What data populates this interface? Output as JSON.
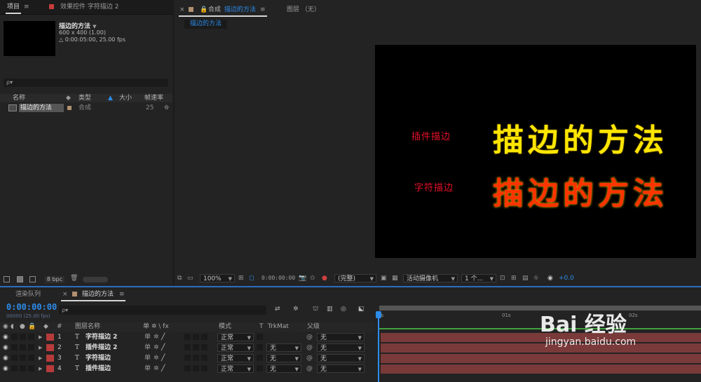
{
  "project_panel": {
    "tab_label": "项目",
    "effects_tab_label": "效果控件 字符描边 2",
    "comp_name": "描边的方法",
    "comp_size": "600 x 400 (1.00)",
    "comp_duration": "△ 0:00:05:00, 25.00 fps",
    "search_placeholder": "ρ▾",
    "columns": {
      "name": "名称",
      "type": "类型",
      "size": "大小",
      "fps": "帧速率"
    },
    "item": {
      "name": "描边的方法",
      "type": "合成",
      "fps": "25"
    },
    "bpc": "8 bpc"
  },
  "comp_panel": {
    "tab_label": "合成",
    "tab_comp_name": "描边的方法",
    "layer_tab_label": "图层 （无）",
    "breadcrumb": "描边的方法",
    "text_plugin_label": "插件描边",
    "text_char_label": "字符描边",
    "big_text_1": "描边的方法",
    "big_text_2": "描边的方法",
    "zoom": "100%",
    "timecode": "0:00:00:00",
    "resolution": "(完整)",
    "camera": "活动摄像机",
    "views": "1 个...",
    "exposure": "+0.0"
  },
  "timeline": {
    "render_queue_label": "渲染队列",
    "comp_tab_label": "描边的方法",
    "timecode": "0:00:00:00",
    "frame_info": "00000 (25.00 fps)",
    "search_placeholder": "ρ▾",
    "ruler": [
      "0s",
      "01s",
      "02s"
    ],
    "headers": {
      "num": "#",
      "layer_name": "图层名称",
      "switches": "单 ✲ \\ fx",
      "mode": "模式",
      "t": "T",
      "trkmat": "TrkMat",
      "parent": "父级"
    },
    "layers": [
      {
        "num": "1",
        "type": "T",
        "name": "字符描边 2",
        "mode": "正常",
        "trkmat": "",
        "parent": "无"
      },
      {
        "num": "2",
        "type": "T",
        "name": "插件描边 2",
        "mode": "正常",
        "trkmat": "无",
        "parent": "无"
      },
      {
        "num": "3",
        "type": "T",
        "name": "字符描边",
        "mode": "正常",
        "trkmat": "无",
        "parent": "无"
      },
      {
        "num": "4",
        "type": "T",
        "name": "插件描边",
        "mode": "正常",
        "trkmat": "无",
        "parent": "无"
      }
    ]
  },
  "watermark": {
    "brand": "Bai 经验",
    "url": "jingyan.baidu.com"
  },
  "colors": {
    "accent_blue": "#2d8ceb",
    "label_red": "#c83c3c",
    "yellow_text": "#ffe600",
    "red_text": "#ff3300",
    "timebar": "#7a3a3a"
  }
}
